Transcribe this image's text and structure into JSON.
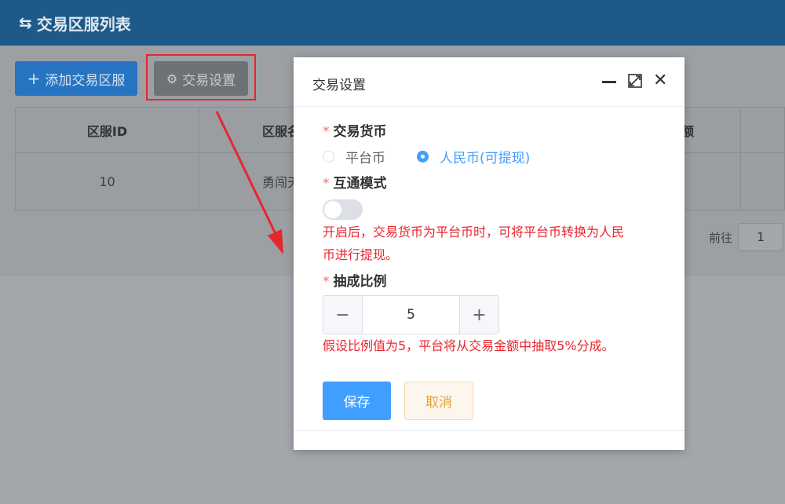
{
  "header": {
    "icon": "swap-icon",
    "title": "交易区服列表"
  },
  "toolbar": {
    "add_label": "添加交易区服",
    "settings_label": "交易设置"
  },
  "table": {
    "columns": [
      "区服ID",
      "区服名",
      "",
      "额",
      ""
    ],
    "rows": [
      [
        "10",
        "勇闯天",
        "",
        "",
        ""
      ]
    ]
  },
  "pagination": {
    "goto_label": "前往",
    "page": "1"
  },
  "dialog": {
    "title": "交易设置",
    "currency": {
      "label": "交易货币",
      "options": [
        "平台币",
        "人民币(可提现)"
      ],
      "selected": "人民币(可提现)"
    },
    "interop": {
      "label": "互通模式",
      "enabled": false,
      "hint_line1": "开启后，交易货币为平台币时，可将平台币转换为人民",
      "hint_line2": "币进行提现。"
    },
    "commission": {
      "label": "抽成比例",
      "value": "5",
      "hint": "假设比例值为5，平台将从交易金额中抽取5%分成。"
    },
    "save_label": "保存",
    "cancel_label": "取消"
  },
  "colors": {
    "primary": "#409eff",
    "danger": "#f56c6c",
    "warning": "#e6a23c",
    "annotation_red": "#e8262d",
    "header_bg": "#1d5a8a"
  }
}
